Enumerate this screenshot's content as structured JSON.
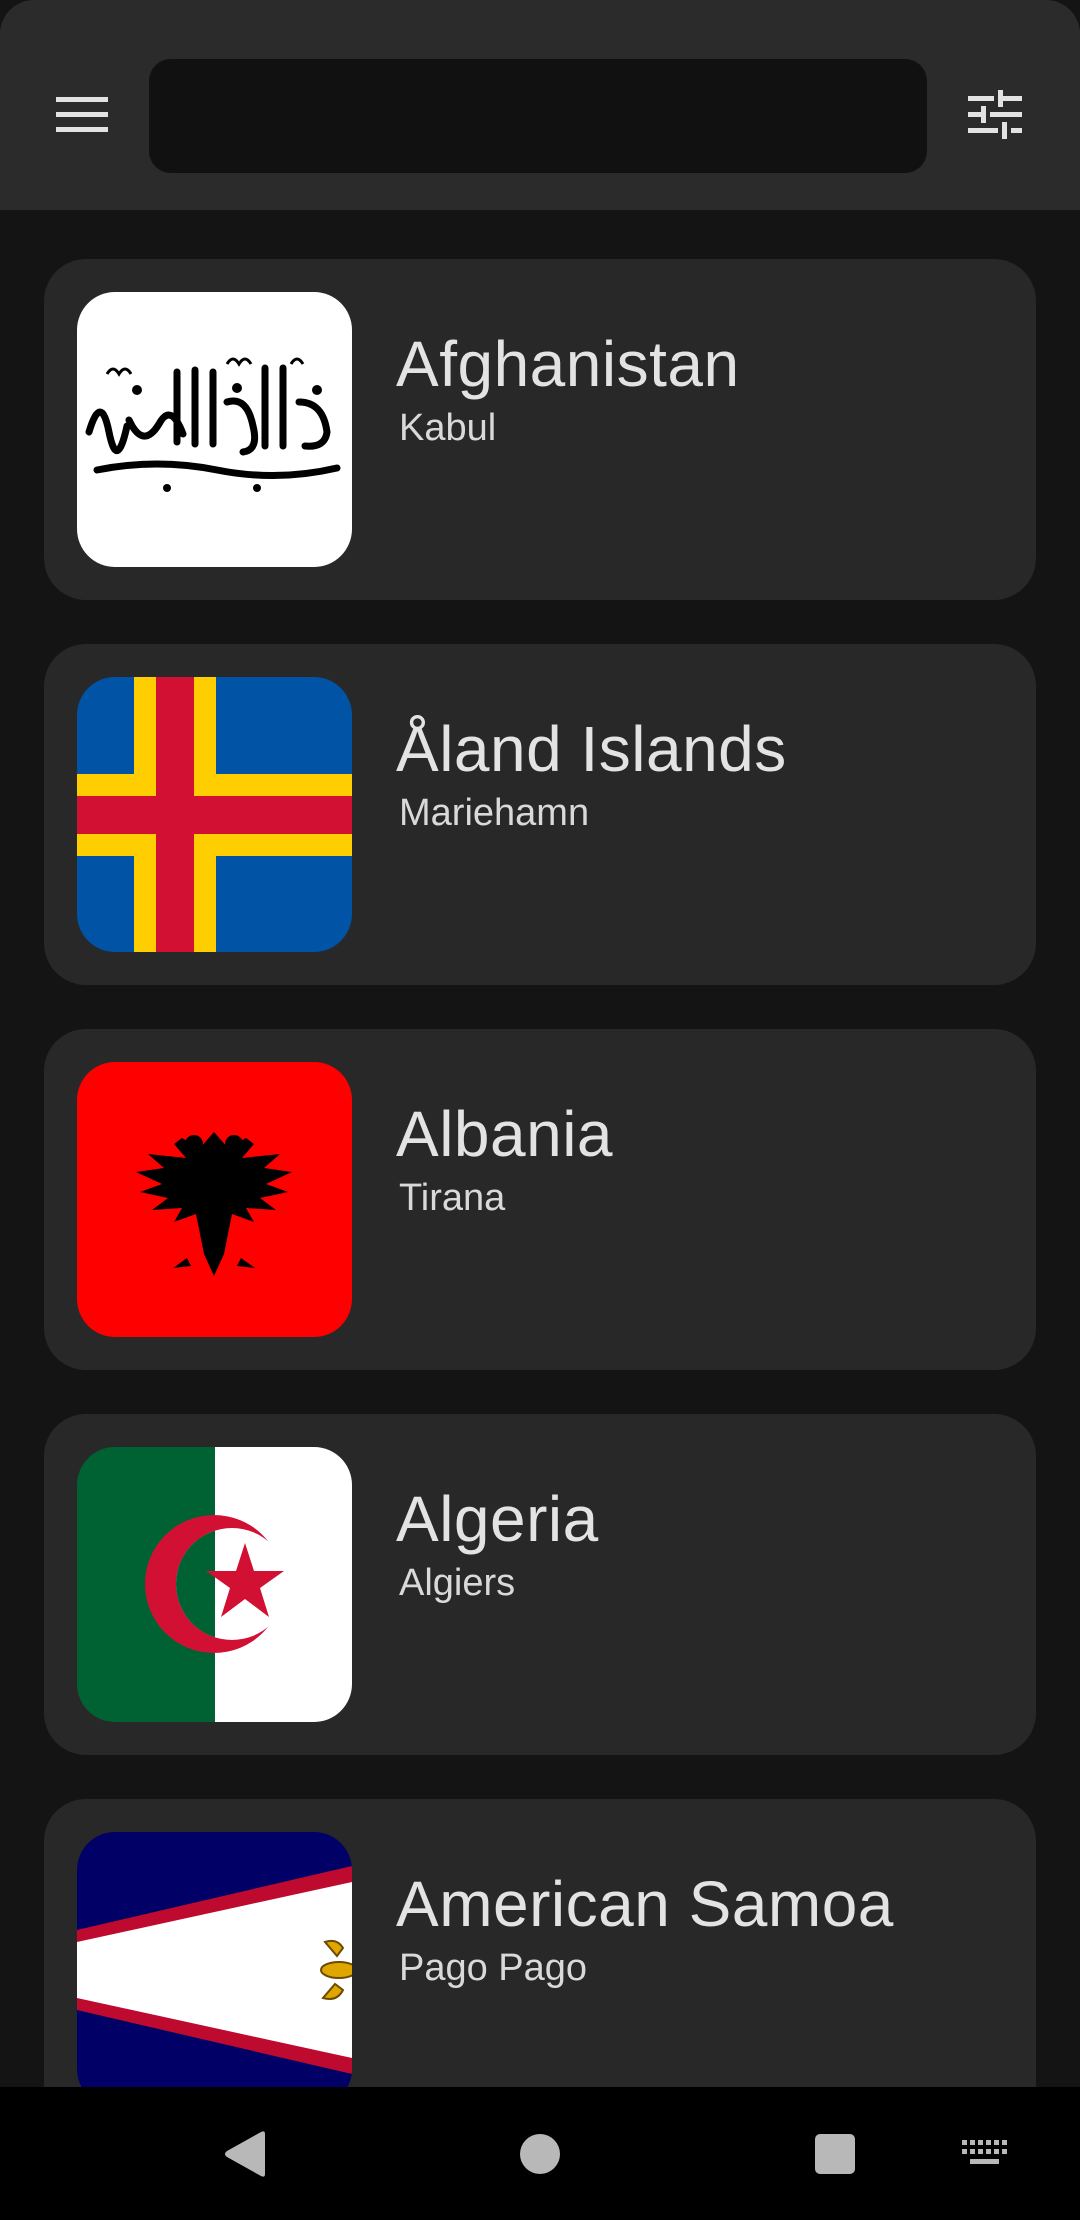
{
  "search": {
    "value": "",
    "placeholder": ""
  },
  "header": {
    "menu_icon": "hamburger-menu-icon",
    "filter_icon": "tune-sliders-icon"
  },
  "countries": [
    {
      "name": "Afghanistan",
      "capital": "Kabul",
      "flag_icon": "afghanistan-flag-icon"
    },
    {
      "name": "Åland Islands",
      "capital": "Mariehamn",
      "flag_icon": "aland-islands-flag-icon"
    },
    {
      "name": "Albania",
      "capital": "Tirana",
      "flag_icon": "albania-flag-icon"
    },
    {
      "name": "Algeria",
      "capital": "Algiers",
      "flag_icon": "algeria-flag-icon"
    },
    {
      "name": "American Samoa",
      "capital": "Pago Pago",
      "flag_icon": "american-samoa-flag-icon"
    }
  ],
  "colors": {
    "background": "#141414",
    "topbar": "#2b2b2b",
    "search_field": "#111111",
    "card": "#282828",
    "text_primary": "#e3e3e3",
    "navbar": "#000000",
    "nav_icons": "#b8b8b8"
  },
  "navigation": {
    "back_icon": "back-triangle-icon",
    "home_icon": "home-circle-icon",
    "recents_icon": "recents-square-icon",
    "keyboard_icon": "keyboard-icon"
  }
}
